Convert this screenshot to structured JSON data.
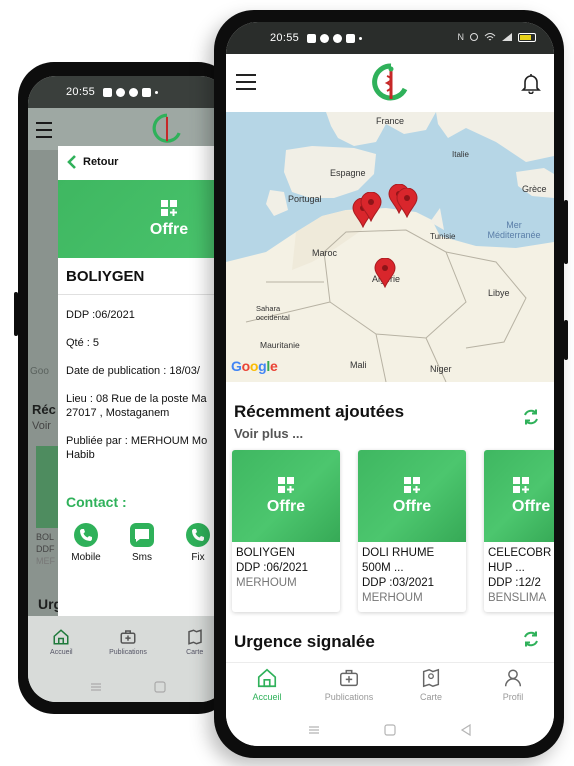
{
  "back_phone": {
    "status_time": "20:55",
    "retour_label": "Retour",
    "offer_banner_label": "Offre",
    "product_title": "BOLIYGEN",
    "ddp_line": "DDP :06/2021",
    "qty_line": "Qté : 5",
    "pub_date_line": "Date de publication : 18/03/",
    "address_line": "Lieu :  08 Rue de la poste Ma 27017 , Mostaganem",
    "published_by_line": "Publiée par : MERHOUM Mo Habib",
    "contact_title": "Contact :",
    "contact_buttons": [
      {
        "label": "Mobile"
      },
      {
        "label": "Sms"
      },
      {
        "label": "Fix"
      }
    ],
    "peek_section": "Urgence signalée",
    "peek_rec": "Réc",
    "peek_voir": "Voir",
    "peek_card_lines": [
      "BOL",
      "DDF",
      "MEF"
    ],
    "peek_google": "Goo",
    "nav": [
      {
        "label": "Accueil"
      },
      {
        "label": "Publications"
      },
      {
        "label": "Carte"
      }
    ]
  },
  "front_phone": {
    "status_time": "20:55",
    "status_right_text": "N",
    "map": {
      "labels": {
        "france": "France",
        "italie": "Italie",
        "espagne": "Espagne",
        "portugal": "Portugal",
        "grece": "Grèce",
        "tunisie": "Tunisie",
        "mer_med": "Mer Méditerranée",
        "maroc": "Maroc",
        "algerie": "Algérie",
        "libye": "Libye",
        "sahara": "Sahara occidental",
        "mauritanie": "Mauritanie",
        "mali": "Mali",
        "niger": "Niger"
      },
      "attribution": "Google"
    },
    "recent_title": "Récemment ajoutées",
    "voir_plus": "Voir plus ...",
    "cards": [
      {
        "banner": "Offre",
        "name": "BOLIYGEN",
        "ddp": "DDP :06/2021",
        "owner": "MERHOUM"
      },
      {
        "banner": "Offre",
        "name": "DOLI RHUME 500M ...",
        "ddp": "DDP :03/2021",
        "owner": "MERHOUM"
      },
      {
        "banner": "Offre",
        "name": "CELECOBR HUP ...",
        "ddp": "DDP :12/2",
        "owner": "BENSLIMA"
      }
    ],
    "urgent_title": "Urgence signalée",
    "nav": [
      {
        "label": "Accueil"
      },
      {
        "label": "Publications"
      },
      {
        "label": "Carte"
      },
      {
        "label": "Profil"
      }
    ]
  },
  "colors": {
    "brand_green": "#2fb15a",
    "banner_green": "#43bd66",
    "pin_red": "#d9262c",
    "map_water": "#b6d6e6",
    "map_land": "#f1efe6",
    "map_desert": "#f4f1e4"
  },
  "icons": [
    "menu-icon",
    "bell-icon",
    "pharmacy-logo",
    "refresh-icon",
    "home-icon",
    "medkit-icon",
    "map-icon",
    "profile-icon",
    "chevron-left-icon",
    "phone-icon",
    "sms-icon"
  ]
}
